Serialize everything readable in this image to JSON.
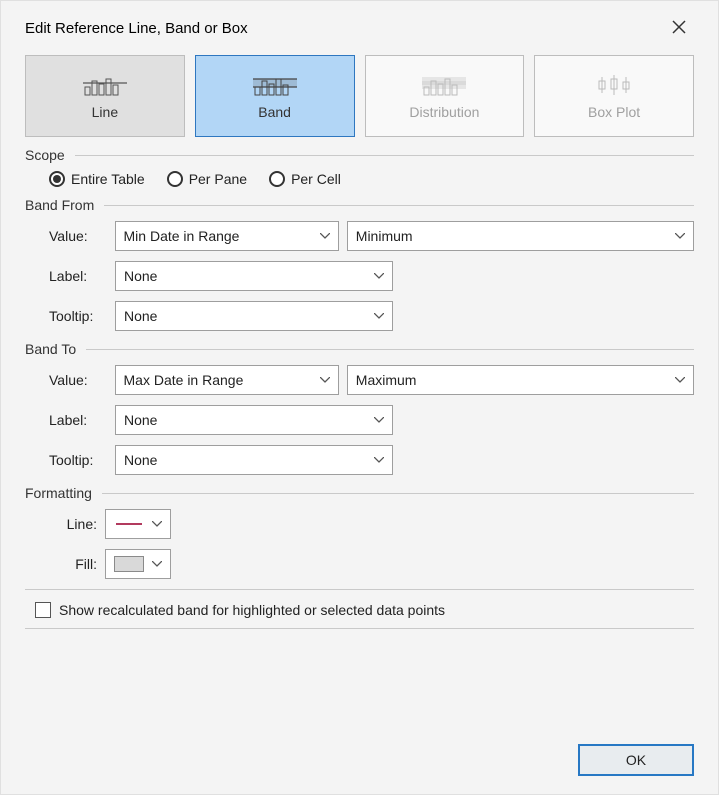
{
  "window": {
    "title": "Edit Reference Line, Band or Box"
  },
  "tabs": {
    "line": "Line",
    "band": "Band",
    "distribution": "Distribution",
    "boxplot": "Box Plot",
    "selected": "band"
  },
  "scope": {
    "legend": "Scope",
    "entire_table": "Entire Table",
    "per_pane": "Per Pane",
    "per_cell": "Per Cell",
    "selected": "entire_table"
  },
  "band_from": {
    "legend": "Band From",
    "value_label": "Value:",
    "value_field": "Min Date in Range",
    "value_agg": "Minimum",
    "label_label": "Label:",
    "label_value": "None",
    "tooltip_label": "Tooltip:",
    "tooltip_value": "None"
  },
  "band_to": {
    "legend": "Band To",
    "value_label": "Value:",
    "value_field": "Max Date in Range",
    "value_agg": "Maximum",
    "label_label": "Label:",
    "label_value": "None",
    "tooltip_label": "Tooltip:",
    "tooltip_value": "None"
  },
  "formatting": {
    "legend": "Formatting",
    "line_label": "Line:",
    "fill_label": "Fill:",
    "line_color": "#b23a5e",
    "fill_color": "#d9d9d9"
  },
  "options": {
    "recalc_label": "Show recalculated band for highlighted or selected data points",
    "recalc_checked": false
  },
  "buttons": {
    "ok": "OK"
  }
}
